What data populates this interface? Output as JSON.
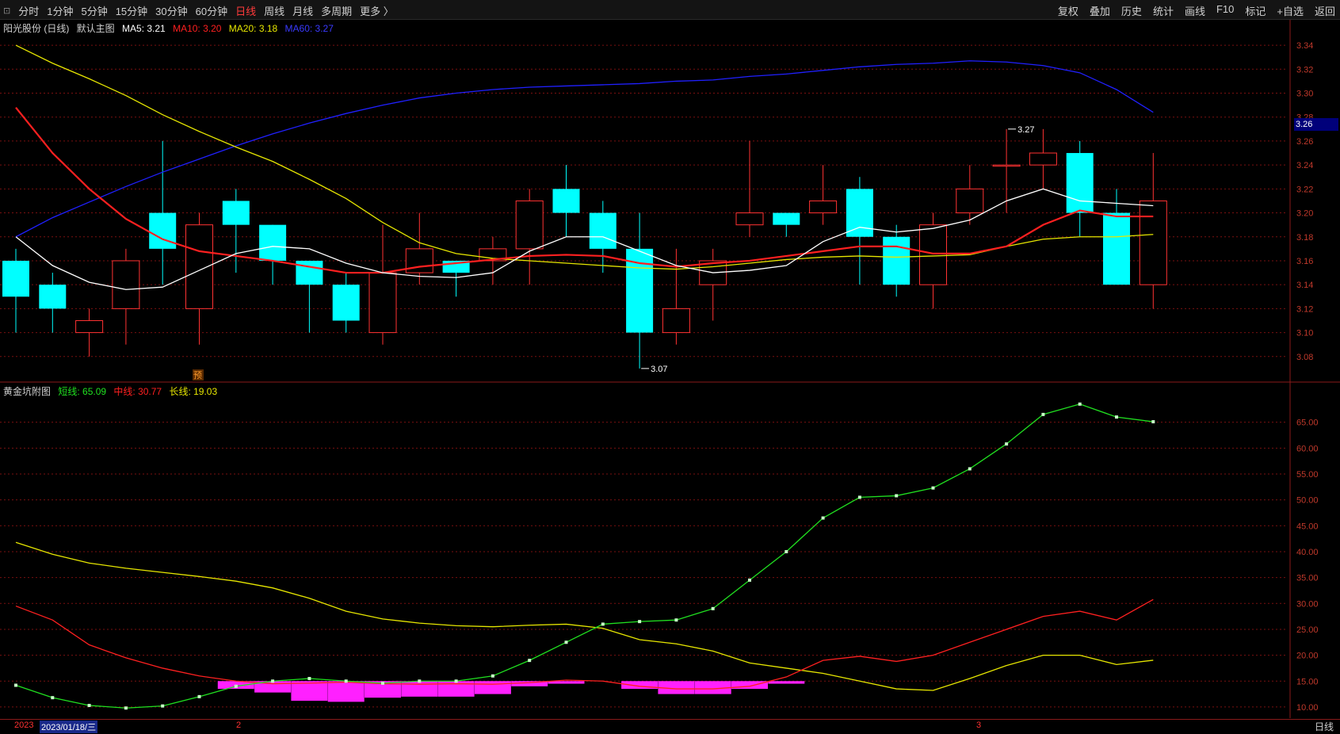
{
  "toolbar": {
    "periods": [
      "分时",
      "1分钟",
      "5分钟",
      "15分钟",
      "30分钟",
      "60分钟",
      "日线",
      "周线",
      "月线",
      "多周期",
      "更多 〉"
    ],
    "active_period": "日线",
    "right_items": [
      "复权",
      "叠加",
      "历史",
      "统计",
      "画线",
      "F10",
      "标记",
      "+自选",
      "返回"
    ]
  },
  "main_info": {
    "stock": "阳光股份 (日线)",
    "chart_name": "默认主图",
    "ma5": "MA5: 3.21",
    "ma10": "MA10: 3.20",
    "ma20": "MA20: 3.18",
    "ma60": "MA60: 3.27"
  },
  "sub_info": {
    "name": "黄金坑附图",
    "short": "短线: 65.09",
    "mid": "中线: 30.77",
    "long": "长线: 19.03"
  },
  "colors": {
    "up": "#ff3232",
    "down": "#00ffff",
    "ma5": "#ffffff",
    "ma10": "#ff2020",
    "ma20": "#e6e600",
    "ma60": "#2020ff",
    "short": "#20e020",
    "mid": "#ff2020",
    "long": "#e6e600",
    "hist": "#ff20ff",
    "grid": "#7a1010"
  },
  "chart_data": [
    {
      "type": "candlestick",
      "ylim": [
        3.06,
        3.35
      ],
      "yticks": [
        "3.34",
        "3.32",
        "3.30",
        "3.28",
        "3.26",
        "3.24",
        "3.22",
        "3.20",
        "3.18",
        "3.16",
        "3.14",
        "3.12",
        "3.10",
        "3.08"
      ],
      "last_price_tag": "3.26",
      "candles": [
        {
          "o": 3.16,
          "h": 3.17,
          "l": 3.1,
          "c": 3.13
        },
        {
          "o": 3.14,
          "h": 3.15,
          "l": 3.1,
          "c": 3.12
        },
        {
          "o": 3.1,
          "h": 3.12,
          "l": 3.08,
          "c": 3.11
        },
        {
          "o": 3.12,
          "h": 3.17,
          "l": 3.09,
          "c": 3.16
        },
        {
          "o": 3.2,
          "h": 3.26,
          "l": 3.14,
          "c": 3.17
        },
        {
          "o": 3.12,
          "h": 3.2,
          "l": 3.09,
          "c": 3.19
        },
        {
          "o": 3.21,
          "h": 3.22,
          "l": 3.15,
          "c": 3.19
        },
        {
          "o": 3.19,
          "h": 3.19,
          "l": 3.14,
          "c": 3.16
        },
        {
          "o": 3.16,
          "h": 3.16,
          "l": 3.1,
          "c": 3.14
        },
        {
          "o": 3.14,
          "h": 3.15,
          "l": 3.1,
          "c": 3.11
        },
        {
          "o": 3.1,
          "h": 3.19,
          "l": 3.09,
          "c": 3.15
        },
        {
          "o": 3.15,
          "h": 3.2,
          "l": 3.14,
          "c": 3.17
        },
        {
          "o": 3.16,
          "h": 3.16,
          "l": 3.13,
          "c": 3.15
        },
        {
          "o": 3.16,
          "h": 3.18,
          "l": 3.14,
          "c": 3.17
        },
        {
          "o": 3.17,
          "h": 3.22,
          "l": 3.14,
          "c": 3.21
        },
        {
          "o": 3.22,
          "h": 3.24,
          "l": 3.18,
          "c": 3.2
        },
        {
          "o": 3.2,
          "h": 3.21,
          "l": 3.15,
          "c": 3.17
        },
        {
          "o": 3.17,
          "h": 3.2,
          "l": 3.07,
          "c": 3.1
        },
        {
          "o": 3.1,
          "h": 3.17,
          "l": 3.09,
          "c": 3.12
        },
        {
          "o": 3.14,
          "h": 3.17,
          "l": 3.11,
          "c": 3.16
        },
        {
          "o": 3.19,
          "h": 3.26,
          "l": 3.18,
          "c": 3.2
        },
        {
          "o": 3.2,
          "h": 3.2,
          "l": 3.18,
          "c": 3.19
        },
        {
          "o": 3.2,
          "h": 3.24,
          "l": 3.19,
          "c": 3.21
        },
        {
          "o": 3.22,
          "h": 3.23,
          "l": 3.14,
          "c": 3.18
        },
        {
          "o": 3.18,
          "h": 3.19,
          "l": 3.13,
          "c": 3.14
        },
        {
          "o": 3.14,
          "h": 3.2,
          "l": 3.12,
          "c": 3.19
        },
        {
          "o": 3.2,
          "h": 3.24,
          "l": 3.19,
          "c": 3.22
        },
        {
          "o": 3.24,
          "h": 3.27,
          "l": 3.2,
          "c": 3.24
        },
        {
          "o": 3.24,
          "h": 3.27,
          "l": 3.22,
          "c": 3.25
        },
        {
          "o": 3.25,
          "h": 3.26,
          "l": 3.18,
          "c": 3.2
        },
        {
          "o": 3.2,
          "h": 3.22,
          "l": 3.14,
          "c": 3.14
        },
        {
          "o": 3.14,
          "h": 3.25,
          "l": 3.12,
          "c": 3.21
        }
      ],
      "ma5": [
        3.18,
        3.156,
        3.142,
        3.136,
        3.138,
        3.152,
        3.166,
        3.172,
        3.17,
        3.158,
        3.15,
        3.147,
        3.146,
        3.15,
        3.168,
        3.18,
        3.18,
        3.168,
        3.156,
        3.15,
        3.152,
        3.156,
        3.176,
        3.188,
        3.184,
        3.187,
        3.194,
        3.21,
        3.22,
        3.21,
        3.208,
        3.206
      ],
      "ma10": [
        3.288,
        3.25,
        3.22,
        3.195,
        3.178,
        3.168,
        3.164,
        3.16,
        3.155,
        3.15,
        3.15,
        3.155,
        3.158,
        3.161,
        3.164,
        3.165,
        3.164,
        3.158,
        3.155,
        3.158,
        3.16,
        3.164,
        3.168,
        3.172,
        3.172,
        3.166,
        3.166,
        3.172,
        3.19,
        3.202,
        3.197,
        3.197
      ],
      "ma20": [
        3.34,
        3.325,
        3.312,
        3.298,
        3.282,
        3.268,
        3.255,
        3.243,
        3.228,
        3.212,
        3.192,
        3.175,
        3.166,
        3.162,
        3.16,
        3.158,
        3.156,
        3.154,
        3.153,
        3.155,
        3.158,
        3.161,
        3.163,
        3.164,
        3.163,
        3.164,
        3.165,
        3.172,
        3.178,
        3.18,
        3.18,
        3.182
      ],
      "ma60": [
        3.18,
        3.196,
        3.209,
        3.222,
        3.234,
        3.245,
        3.256,
        3.266,
        3.275,
        3.283,
        3.29,
        3.296,
        3.3,
        3.303,
        3.305,
        3.306,
        3.307,
        3.308,
        3.31,
        3.311,
        3.314,
        3.316,
        3.319,
        3.322,
        3.324,
        3.325,
        3.327,
        3.326,
        3.323,
        3.317,
        3.303,
        3.284
      ],
      "annotations": [
        {
          "label": "3.27",
          "index": 27
        },
        {
          "label": "3.07",
          "index": 17
        }
      ],
      "marker": "预"
    },
    {
      "type": "line",
      "name": "黄金坑附图",
      "ylim": [
        8,
        70
      ],
      "yticks": [
        "65.00",
        "60.00",
        "55.00",
        "50.00",
        "45.00",
        "40.00",
        "35.00",
        "30.00",
        "25.00",
        "20.00",
        "15.00",
        "10.00"
      ],
      "short": [
        14.2,
        11.8,
        10.3,
        9.8,
        10.2,
        12.0,
        14.0,
        15.0,
        15.5,
        15.0,
        14.6,
        15.0,
        15.0,
        16.0,
        19.0,
        22.5,
        26.0,
        26.5,
        26.8,
        29.0,
        34.5,
        40.0,
        46.5,
        50.5,
        50.8,
        52.3,
        56.0,
        60.8,
        66.5,
        68.5,
        66.0,
        65.09
      ],
      "mid": [
        29.5,
        26.8,
        22.0,
        19.5,
        17.5,
        16.0,
        15.0,
        14.5,
        14.6,
        14.8,
        14.5,
        14.4,
        14.5,
        14.4,
        14.7,
        15.2,
        15.0,
        14.0,
        13.5,
        13.5,
        14.0,
        15.8,
        19.0,
        19.8,
        18.8,
        20.0,
        22.5,
        25.0,
        27.5,
        28.5,
        26.8,
        30.77
      ],
      "long": [
        41.8,
        39.5,
        37.8,
        36.8,
        36.0,
        35.2,
        34.3,
        33.0,
        31.0,
        28.5,
        27.0,
        26.2,
        25.7,
        25.5,
        25.8,
        26.0,
        25.2,
        23.0,
        22.2,
        20.8,
        18.5,
        17.5,
        16.5,
        15.0,
        13.5,
        13.2,
        15.5,
        18.0,
        20.0,
        20.0,
        18.2,
        19.03
      ],
      "hist": [
        0,
        0,
        0,
        0,
        0,
        0,
        -1.5,
        -2.2,
        -3.8,
        -4.0,
        -3.2,
        -3.0,
        -3.0,
        -2.5,
        -1.0,
        -0.5,
        0,
        -1.5,
        -2.5,
        -2.5,
        -1.5,
        -0.5,
        0,
        0,
        0,
        0,
        0,
        0,
        0,
        0,
        0,
        0
      ],
      "hist_base": 15.0
    }
  ],
  "bottom": {
    "year": "2023",
    "date": "2023/01/18/三",
    "month_mark_1": "2",
    "month_mark_2": "3",
    "period": "日线"
  }
}
